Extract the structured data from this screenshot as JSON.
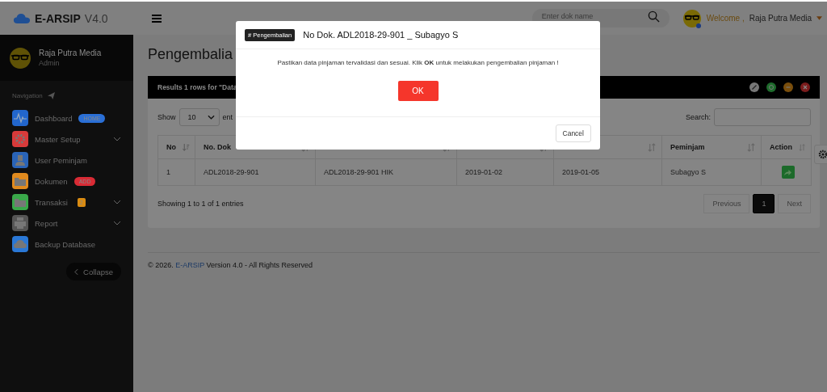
{
  "topbar": {
    "brand": "E-ARSIP",
    "version": "V4.0",
    "search": {
      "placeholder": "Enter dok name"
    },
    "welcome": "Welcome ,",
    "user_name": "Raja Putra Media"
  },
  "sidebar": {
    "profile": {
      "name": "Raja Putra Media",
      "role": "Admin"
    },
    "nav_heading": "Navigation",
    "items": [
      {
        "label": "Dashboard",
        "color": "#2266cc",
        "badge": {
          "text": "HOME",
          "color": "#2a6fd6"
        },
        "expandable": false
      },
      {
        "label": "Master Setup",
        "color": "#d83a3a",
        "expandable": true
      },
      {
        "label": "User Peminjam",
        "color": "#2a64b8",
        "expandable": false
      },
      {
        "label": "Dokumen",
        "color": "#e08a1e",
        "badge": {
          "text": "ADD",
          "color": "#d92b35"
        },
        "expandable": false
      },
      {
        "label": "Transaksi",
        "color": "#3aa84a",
        "badge": {
          "text": "2",
          "color": "#d98b12"
        },
        "expandable": true
      },
      {
        "label": "Report",
        "color": "#555555",
        "expandable": true
      },
      {
        "label": "Backup Database",
        "color": "#2a78d6",
        "expandable": false
      }
    ],
    "collapse": "Collapse"
  },
  "page_title": "Pengembalia",
  "panel": {
    "results_text": "Results 1 rows for \"Data",
    "show_label": "Show",
    "page_length": "10",
    "entries_label": "ent",
    "search_label": "Search:"
  },
  "table": {
    "columns": [
      {
        "label": "No",
        "sorted": true
      },
      {
        "label": "No. Dok",
        "sorted": false
      },
      {
        "sorted": false
      },
      {
        "sorted": false
      },
      {
        "sorted": false
      },
      {
        "label": "Peminjam",
        "sorted": false
      },
      {
        "label": "Action",
        "sorted": false
      }
    ],
    "rows": [
      {
        "cells": [
          "1",
          "ADL2018-29-901",
          "ADL2018-29-901 HIK",
          "2019-01-02",
          "2019-01-05",
          "Subagyo S"
        ]
      }
    ]
  },
  "info": "Showing 1 to 1 of 1 entries",
  "pagination": [
    {
      "label": "Previous",
      "selected": false,
      "disabled": true
    },
    {
      "label": "1",
      "selected": true,
      "disabled": false
    },
    {
      "label": "Next",
      "selected": false,
      "disabled": true
    }
  ],
  "footer": {
    "prefix": "© 2026.",
    "link": "E-ARSIP",
    "suffix": "Version 4.0 - All Rights Reserved"
  },
  "modal": {
    "badge": "# Pengembalian",
    "title": "No Dok. ADL2018-29-901 _ Subagyo S",
    "message": "Pastikan data pinjaman tervalidasi dan sesuai. Klik **OK** untuk melakukan pengembalian pinjaman !",
    "ok": "OK",
    "cancel": "Cancel"
  }
}
